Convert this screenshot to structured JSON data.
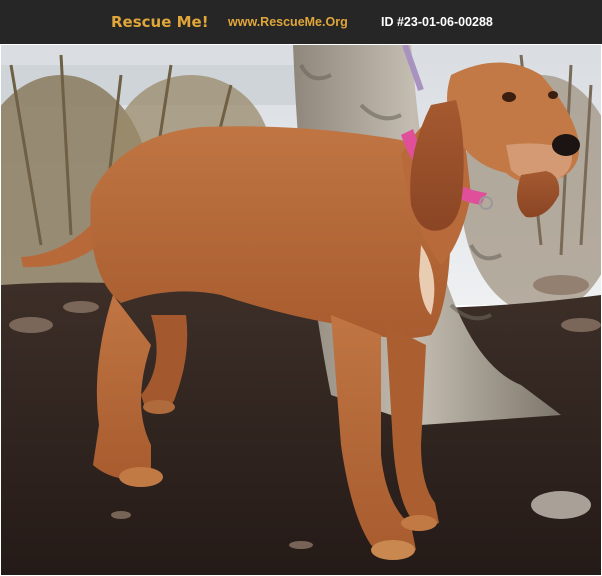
{
  "banner": {
    "brand": "Rescue Me!",
    "site": "www.RescueMe.Org",
    "pet_id": "ID #23-01-06-00288"
  },
  "photo": {
    "subject": "dog-icon",
    "colors": {
      "coat": "#b8693a",
      "collar": "#e0509a",
      "ground": "#2e2320",
      "trunk": "#a9a296"
    }
  }
}
